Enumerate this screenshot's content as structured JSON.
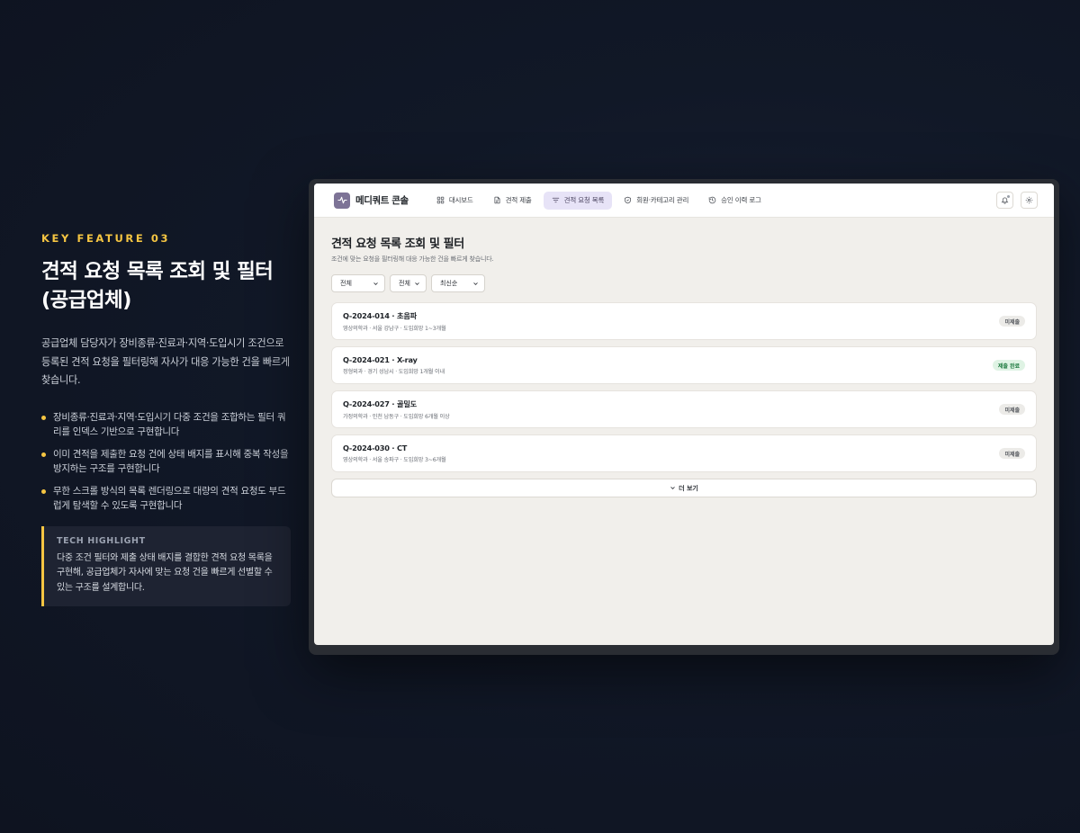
{
  "feature": {
    "eyebrow": "KEY FEATURE 03",
    "title_line1": "견적 요청 목록 조회 및 필터",
    "title_line2": "(공급업체)",
    "description": "공급업체 담당자가 장비종류·진료과·지역·도입시기 조건으로 등록된 견적 요청을 필터링해 자사가 대응 가능한 건을 빠르게 찾습니다.",
    "bullets": [
      "장비종류·진료과·지역·도입시기 다중 조건을 조합하는 필터 쿼리를 인덱스 기반으로 구현합니다",
      "이미 견적을 제출한 요청 건에 상태 배지를 표시해 중복 작성을 방지하는 구조를 구현합니다",
      "무한 스크롤 방식의 목록 렌더링으로 대량의 견적 요청도 부드럽게 탐색할 수 있도록 구현합니다"
    ],
    "tech": {
      "title": "TECH HIGHLIGHT",
      "body": "다중 조건 필터와 제출 상태 배지를 결합한 견적 요청 목록을 구현해, 공급업체가 자사에 맞는 요청 건을 빠르게 선별할 수 있는 구조를 설계합니다."
    }
  },
  "app": {
    "brand": "메디쿼트 콘솔",
    "nav": [
      {
        "label": "대시보드",
        "icon": "grid-icon"
      },
      {
        "label": "견적 제출",
        "icon": "document-icon"
      },
      {
        "label": "견적 요청 목록",
        "icon": "filter-icon",
        "active": true
      },
      {
        "label": "회원·카테고리 관리",
        "icon": "shield-icon"
      },
      {
        "label": "승인 이력 로그",
        "icon": "history-icon"
      }
    ],
    "page_title": "견적 요청 목록 조회 및 필터",
    "page_subtitle": "조건에 맞는 요청을 필터링해 대응 가능한 건을 빠르게 찾습니다.",
    "filters": [
      "전체",
      "전체",
      "최신순"
    ],
    "requests": [
      {
        "title": "Q-2024-014 · 초음파",
        "meta": "영상의학과 · 서울 강남구 · 도입희망 1~3개월",
        "status": "미제출",
        "status_type": "pending"
      },
      {
        "title": "Q-2024-021 · X-ray",
        "meta": "정형외과 · 경기 성남시 · 도입희망 1개월 이내",
        "status": "제출 완료",
        "status_type": "done"
      },
      {
        "title": "Q-2024-027 · 골밀도",
        "meta": "가정의학과 · 인천 남동구 · 도입희망 6개월 이상",
        "status": "미제출",
        "status_type": "pending"
      },
      {
        "title": "Q-2024-030 · CT",
        "meta": "영상의학과 · 서울 송파구 · 도입희망 3~6개월",
        "status": "미제출",
        "status_type": "pending"
      }
    ],
    "load_more": "더 보기",
    "colors": {
      "accent": "#f5c542",
      "nav_active_bg": "#e7e3f7",
      "brand_logo": "#7d7396",
      "badge_done": "#1e7a3f"
    }
  }
}
